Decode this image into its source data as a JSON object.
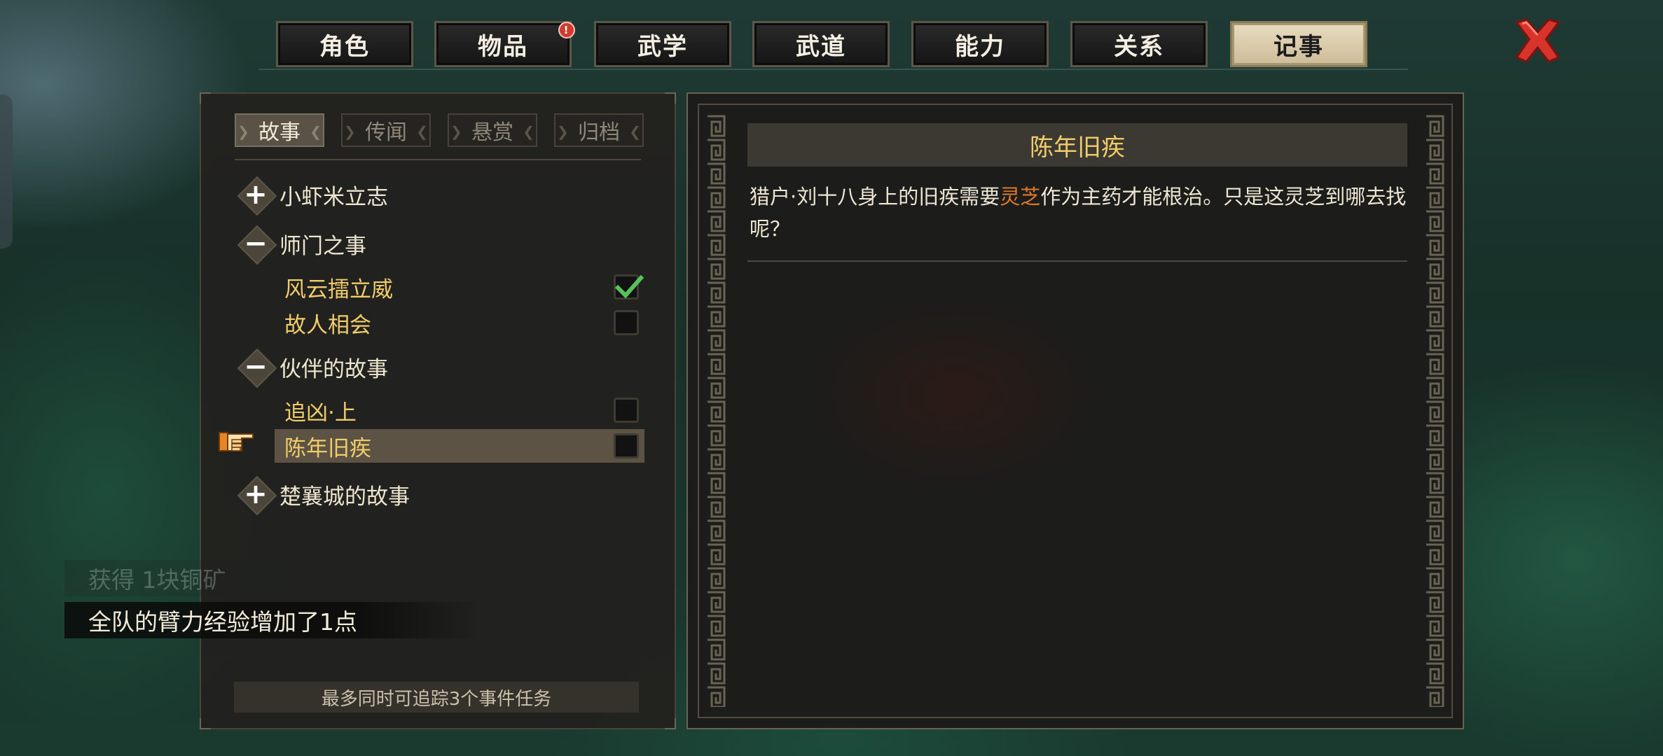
{
  "tabs": [
    {
      "label": "角色",
      "active": false
    },
    {
      "label": "物品",
      "active": false,
      "badge": "!"
    },
    {
      "label": "武学",
      "active": false
    },
    {
      "label": "武道",
      "active": false
    },
    {
      "label": "能力",
      "active": false
    },
    {
      "label": "关系",
      "active": false
    },
    {
      "label": "记事",
      "active": true
    }
  ],
  "journal": {
    "subtabs": [
      {
        "label": "故事",
        "active": true
      },
      {
        "label": "传闻",
        "active": false
      },
      {
        "label": "悬赏",
        "active": false
      },
      {
        "label": "归档",
        "active": false
      }
    ],
    "groups": [
      {
        "label": "小虾米立志",
        "expanded": false,
        "toggle": "+"
      },
      {
        "label": "师门之事",
        "expanded": true,
        "toggle": "−"
      },
      {
        "label": "伙伴的故事",
        "expanded": true,
        "toggle": "−"
      },
      {
        "label": "楚襄城的故事",
        "expanded": false,
        "toggle": "+"
      }
    ],
    "quests": [
      {
        "label": "风云擂立威",
        "checked": true
      },
      {
        "label": "故人相会",
        "checked": false
      },
      {
        "label": "追凶·上",
        "checked": false
      },
      {
        "label": "陈年旧疾",
        "checked": false,
        "selected": true
      }
    ],
    "track_note": "最多同时可追踪3个事件任务"
  },
  "notifications": {
    "faded": "获得 1块铜矿",
    "main": "全队的臂力经验增加了1点"
  },
  "detail": {
    "title": "陈年旧疾",
    "desc_part1": "猎户·刘十八身上的旧疾需要",
    "desc_highlight": "灵芝",
    "desc_part2": "作为主药才能根治。只是这灵芝到哪去找呢？",
    "highlight_color": "#e07a2b"
  },
  "icons": {
    "close": "close-x-icon",
    "pointer": "pointing-hand-icon",
    "check": "checkmark-icon"
  },
  "colors": {
    "quest_text": "#f0cc6a",
    "active_tab_bg": "#e9dcc0",
    "check_green": "#58c25a"
  }
}
